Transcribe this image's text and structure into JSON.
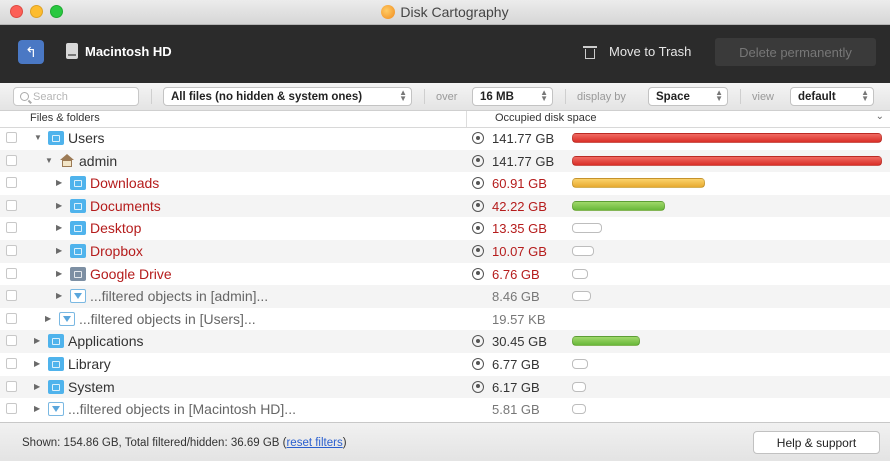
{
  "window": {
    "title": "Disk Cartography"
  },
  "toolbar": {
    "back_icon": "back-arrow-icon",
    "disk_name": "Macintosh HD",
    "move_to_trash": "Move to Trash",
    "delete_permanently": "Delete permanently"
  },
  "filters": {
    "search_placeholder": "Search",
    "file_type": "All files (no hidden & system ones)",
    "over_label": "over",
    "over_value": "16 MB",
    "display_by_label": "display by",
    "display_by_value": "Space",
    "view_label": "view",
    "view_value": "default"
  },
  "columns": {
    "files": "Files & folders",
    "space": "Occupied disk space"
  },
  "rows": [
    {
      "name": "Users",
      "size": "141.77 GB",
      "depth": 0,
      "expanded": true,
      "color": "normal",
      "icon": "folder-users-icon",
      "visible": true,
      "fraction": 1.0,
      "bar": "red"
    },
    {
      "name": "admin",
      "size": "141.77 GB",
      "depth": 1,
      "expanded": true,
      "color": "normal",
      "icon": "home-icon",
      "visible": true,
      "fraction": 1.0,
      "bar": "red"
    },
    {
      "name": "Downloads",
      "size": "60.91 GB",
      "depth": 2,
      "expanded": false,
      "color": "red",
      "icon": "folder-downloads-icon",
      "visible": true,
      "fraction": 0.43,
      "bar": "orange"
    },
    {
      "name": "Documents",
      "size": "42.22 GB",
      "depth": 2,
      "expanded": false,
      "color": "red",
      "icon": "folder-documents-icon",
      "visible": true,
      "fraction": 0.3,
      "bar": "green"
    },
    {
      "name": "Desktop",
      "size": "13.35 GB",
      "depth": 2,
      "expanded": false,
      "color": "red",
      "icon": "folder-desktop-icon",
      "visible": true,
      "fraction": 0.1,
      "bar": "empty"
    },
    {
      "name": "Dropbox",
      "size": "10.07 GB",
      "depth": 2,
      "expanded": false,
      "color": "red",
      "icon": "folder-dropbox-icon",
      "visible": true,
      "fraction": 0.07,
      "bar": "empty"
    },
    {
      "name": "Google Drive",
      "size": "6.76 GB",
      "depth": 2,
      "expanded": false,
      "color": "red",
      "icon": "folder-google-drive-icon",
      "visible": true,
      "fraction": 0.05,
      "bar": "empty"
    },
    {
      "name": "...filtered objects in [admin]...",
      "size": "8.46 GB",
      "depth": 2,
      "expanded": false,
      "color": "grey",
      "icon": "filter-icon",
      "visible": false,
      "fraction": 0.06,
      "bar": "empty"
    },
    {
      "name": "...filtered objects in [Users]...",
      "size": "19.57 KB",
      "depth": 1,
      "expanded": false,
      "color": "grey",
      "icon": "filter-icon",
      "visible": false,
      "fraction": 0,
      "bar": "none"
    },
    {
      "name": "Applications",
      "size": "30.45 GB",
      "depth": 0,
      "expanded": false,
      "color": "normal",
      "icon": "folder-applications-icon",
      "visible": true,
      "fraction": 0.22,
      "bar": "green"
    },
    {
      "name": "Library",
      "size": "6.77 GB",
      "depth": 0,
      "expanded": false,
      "color": "normal",
      "icon": "folder-library-icon",
      "visible": true,
      "fraction": 0.05,
      "bar": "empty"
    },
    {
      "name": "System",
      "size": "6.17 GB",
      "depth": 0,
      "expanded": false,
      "color": "normal",
      "icon": "folder-system-icon",
      "visible": true,
      "fraction": 0.04,
      "bar": "empty"
    },
    {
      "name": "...filtered objects in [Macintosh HD]...",
      "size": "5.81 GB",
      "depth": 0,
      "expanded": false,
      "color": "grey",
      "icon": "filter-icon",
      "visible": false,
      "fraction": 0.04,
      "bar": "empty"
    }
  ],
  "status": {
    "text": "Shown: 154.86 GB, Total filtered/hidden: 36.69 GB (",
    "link": "reset filters",
    "close": ")",
    "help_button": "Help & support"
  },
  "colors": {
    "toolbar_bg": "#2b2b2b",
    "accent_blue": "#4a78c4",
    "text_red": "#b51c1c",
    "bar_red": "#d92e27",
    "bar_orange": "#e7aa30",
    "bar_green": "#69b83a"
  }
}
